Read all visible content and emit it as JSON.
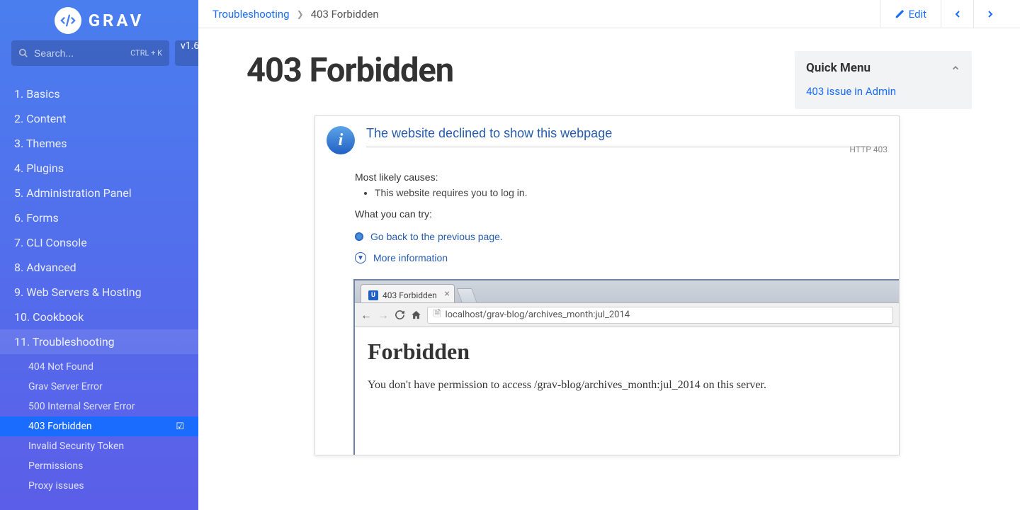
{
  "brand": "GRAV",
  "search": {
    "placeholder": "Search...",
    "shortcut": "CTRL + K"
  },
  "version": "v1.6",
  "nav": [
    {
      "n": "1.",
      "label": "Basics"
    },
    {
      "n": "2.",
      "label": "Content"
    },
    {
      "n": "3.",
      "label": "Themes"
    },
    {
      "n": "4.",
      "label": "Plugins"
    },
    {
      "n": "5.",
      "label": "Administration Panel"
    },
    {
      "n": "6.",
      "label": "Forms"
    },
    {
      "n": "7.",
      "label": "CLI Console"
    },
    {
      "n": "8.",
      "label": "Advanced"
    },
    {
      "n": "9.",
      "label": "Web Servers & Hosting"
    },
    {
      "n": "10.",
      "label": "Cookbook"
    },
    {
      "n": "11.",
      "label": "Troubleshooting"
    }
  ],
  "subnav": [
    {
      "label": "404 Not Found"
    },
    {
      "label": "Grav Server Error"
    },
    {
      "label": "500 Internal Server Error"
    },
    {
      "label": "403 Forbidden"
    },
    {
      "label": "Invalid Security Token"
    },
    {
      "label": "Permissions"
    },
    {
      "label": "Proxy issues"
    }
  ],
  "breadcrumb": {
    "parent": "Troubleshooting",
    "current": "403 Forbidden"
  },
  "edit_label": "Edit",
  "page_title": "403 Forbidden",
  "quick_menu": {
    "title": "Quick Menu",
    "links": [
      "403 issue in Admin"
    ]
  },
  "ie_error": {
    "title": "The website declined to show this webpage",
    "status": "HTTP 403",
    "causes_label": "Most likely causes:",
    "causes": [
      "This website requires you to log in."
    ],
    "try_label": "What you can try:",
    "links": [
      "Go back to the previous page."
    ],
    "more": "More information"
  },
  "chrome": {
    "tab_title": "403 Forbidden",
    "url": "localhost/grav-blog/archives_month:jul_2014",
    "h1": "Forbidden",
    "p": "You don't have permission to access /grav-blog/archives_month:jul_2014 on this server."
  }
}
